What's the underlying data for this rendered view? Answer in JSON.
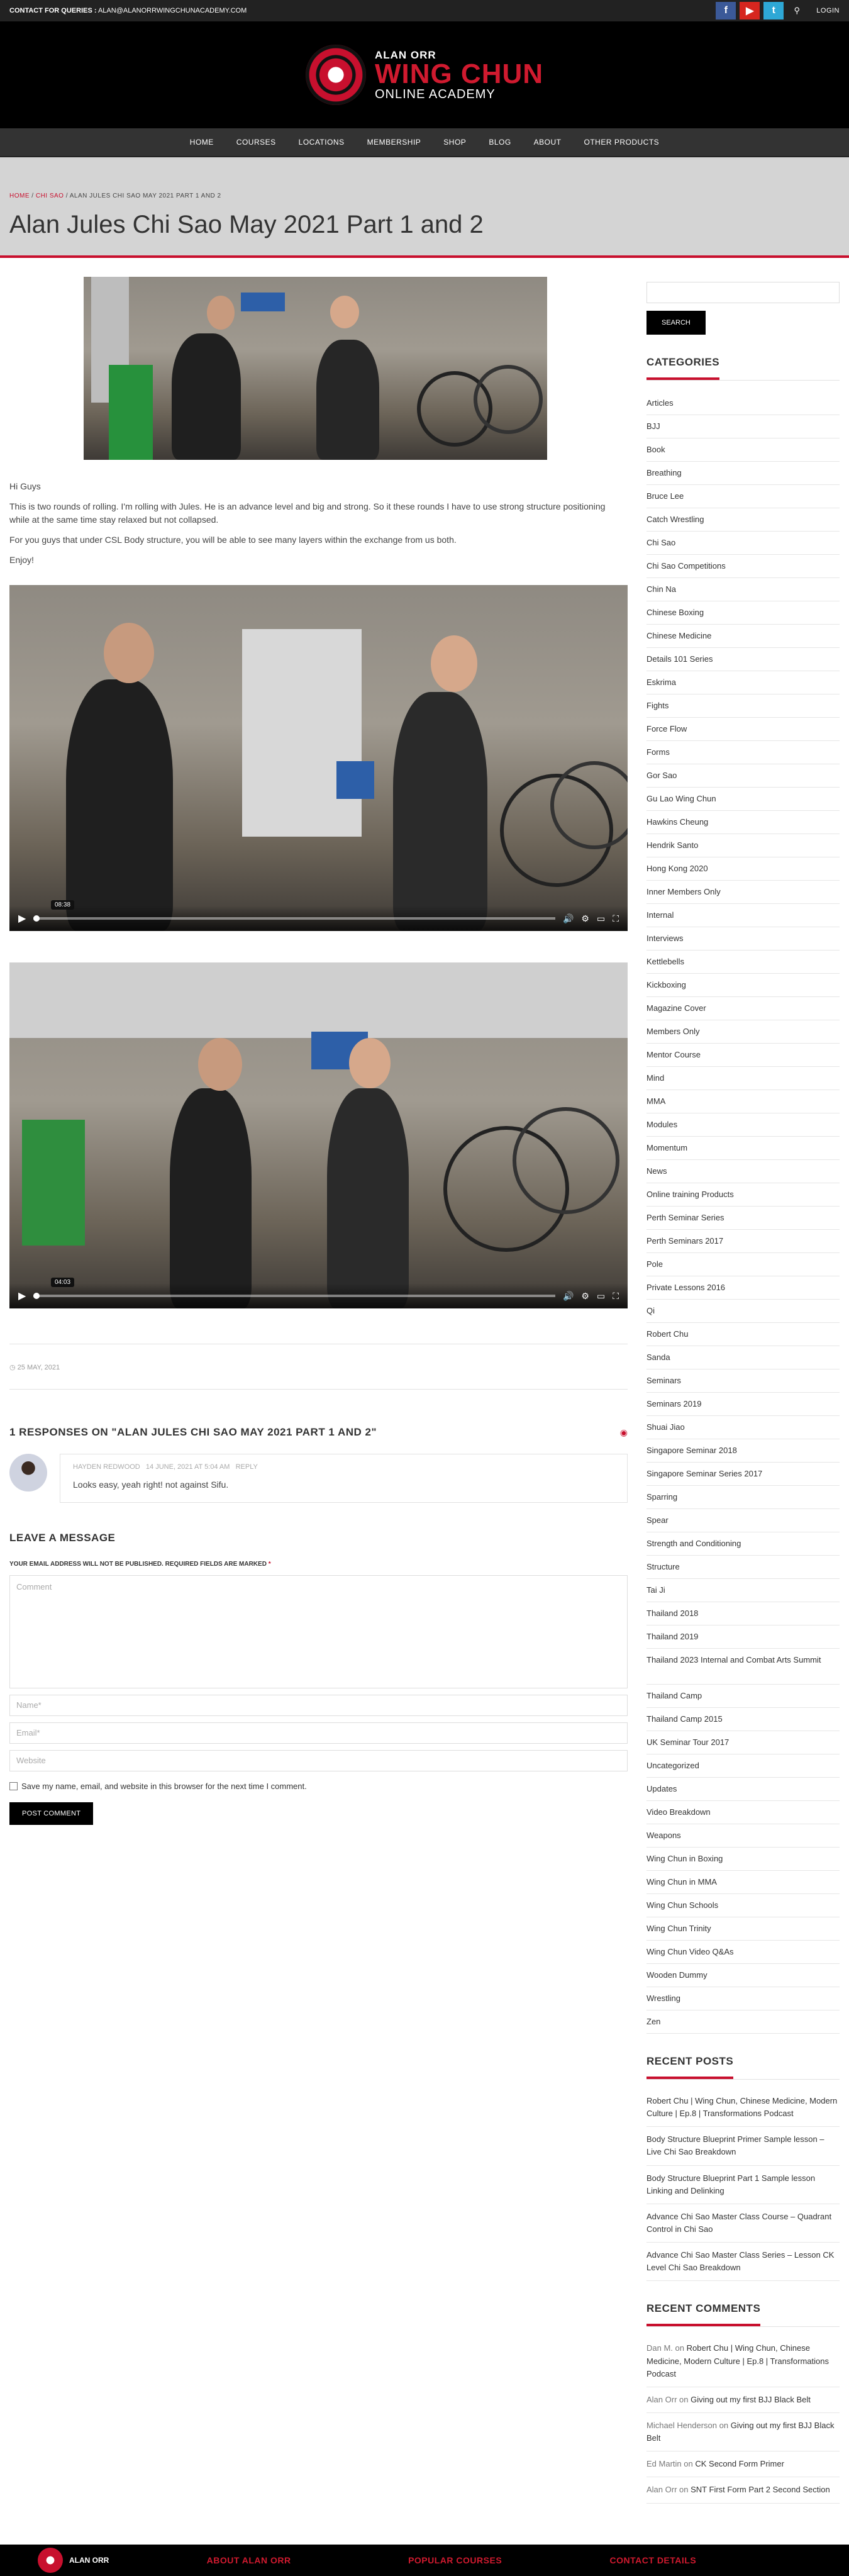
{
  "topbar": {
    "contact_label": "CONTACT FOR QUERIES :",
    "contact_email": "ALAN@ALANORRWINGCHUNACADEMY.COM",
    "fb_glyph": "f",
    "yt_glyph": "▶",
    "tw_glyph": "t",
    "search_glyph": "⚲",
    "login": "LOGIN"
  },
  "logo": {
    "line1": "ALAN ORR",
    "line2": "WING CHUN",
    "line3": "ONLINE ACADEMY"
  },
  "nav": [
    "HOME",
    "COURSES",
    "LOCATIONS",
    "MEMBERSHIP",
    "SHOP",
    "BLOG",
    "ABOUT",
    "OTHER PRODUCTS"
  ],
  "breadcrumb": {
    "home": "HOME",
    "sep": "/",
    "cat": "CHI SAO",
    "current": "ALAN JULES CHI SAO MAY 2021 PART 1 AND 2"
  },
  "page_title": "Alan Jules Chi Sao May 2021 Part 1 and 2",
  "post": {
    "p1": "Hi Guys",
    "p2": "This is two rounds of rolling. I'm rolling with Jules. He is an advance level and big and strong. So it these rounds I have to use strong structure positioning while at the same time stay relaxed but not collapsed.",
    "p3": "For you guys that under CSL Body structure, you will be able to see many layers within the exchange from us both.",
    "p4": "Enjoy!"
  },
  "videos": [
    {
      "time": "08:38",
      "progress": 0
    },
    {
      "time": "04:03",
      "progress": 0
    }
  ],
  "icons": {
    "play": "▶",
    "volume": "🔊",
    "settings": "⚙",
    "pip": "▭",
    "fullscreen": "⛶",
    "clock": "◷",
    "rss": "◉"
  },
  "date": "25 MAY, 2021",
  "responses_title": "1 RESPONSES ON \"ALAN JULES CHI SAO MAY 2021 PART 1 AND 2\"",
  "comment": {
    "author": "HAYDEN REDWOOD",
    "date": "14 JUNE, 2021 AT 5:04 AM",
    "reply": "REPLY",
    "text": "Looks easy, yeah right! not against Sifu."
  },
  "form": {
    "title": "LEAVE A MESSAGE",
    "notice": "YOUR EMAIL ADDRESS WILL NOT BE PUBLISHED. REQUIRED FIELDS ARE MARKED",
    "req": "*",
    "comment_ph": "Comment",
    "name_ph": "Name*",
    "email_ph": "Email*",
    "website_ph": "Website",
    "save_label": "Save my name, email, and website in this browser for the next time I comment.",
    "submit": "POST COMMENT"
  },
  "sidebar": {
    "search_btn": "SEARCH",
    "categories_title": "CATEGORIES",
    "categories": [
      "Articles",
      "BJJ",
      "Book",
      "Breathing",
      "Bruce Lee",
      "Catch Wrestling",
      "Chi Sao",
      "Chi Sao Competitions",
      "Chin Na",
      "Chinese Boxing",
      "Chinese Medicine",
      "Details 101 Series",
      "Eskrima",
      "Fights",
      "Force Flow",
      "Forms",
      "Gor Sao",
      "Gu Lao Wing Chun",
      "Hawkins Cheung",
      "Hendrik Santo",
      "Hong Kong 2020",
      "Inner Members Only",
      "Internal",
      "Interviews",
      "Kettlebells",
      "Kickboxing",
      "Magazine Cover",
      "Members Only",
      "Mentor Course",
      "Mind",
      "MMA",
      "Modules",
      "Momentum",
      "News",
      "Online training Products",
      "Perth Seminar Series",
      "Perth Seminars 2017",
      "Pole",
      "Private Lessons 2016",
      "Qi",
      "Robert Chu",
      "Sanda",
      "Seminars",
      "Seminars 2019",
      "Shuai Jiao",
      "Singapore Seminar 2018",
      "Singapore Seminar Series 2017",
      "Sparring",
      "Spear",
      "Strength and Conditioning",
      "Structure",
      "Tai Ji",
      "Thailand 2018",
      "Thailand 2019",
      "Thailand 2023 Internal and Combat Arts Summit",
      "Thailand Camp",
      "Thailand Camp 2015",
      "UK Seminar Tour 2017",
      "Uncategorized",
      "Updates",
      "Video Breakdown",
      "Weapons",
      "Wing Chun in Boxing",
      "Wing Chun in MMA",
      "Wing Chun Schools",
      "Wing Chun Trinity",
      "Wing Chun Video Q&As",
      "Wooden Dummy",
      "Wrestling",
      "Zen"
    ],
    "recent_posts_title": "RECENT POSTS",
    "recent_posts": [
      "Robert Chu | Wing Chun, Chinese Medicine, Modern Culture | Ep.8 | Transformations Podcast",
      "Body Structure Blueprint Primer Sample lesson – Live Chi Sao Breakdown",
      "Body Structure Blueprint Part 1 Sample lesson Linking and Delinking",
      "Advance Chi Sao Master Class Course – Quadrant Control in Chi Sao",
      "Advance Chi Sao Master Class Series – Lesson CK Level Chi Sao Breakdown"
    ],
    "recent_comments_title": "RECENT COMMENTS",
    "recent_comments": [
      {
        "author": "Dan M.",
        "on": "on",
        "post": "Robert Chu | Wing Chun, Chinese Medicine, Modern Culture | Ep.8 | Transformations Podcast"
      },
      {
        "author": "Alan Orr",
        "on": "on",
        "post": "Giving out my first BJJ Black Belt"
      },
      {
        "author": "Michael Henderson",
        "on": "on",
        "post": "Giving out my first BJJ Black Belt"
      },
      {
        "author": "Ed Martin",
        "on": "on",
        "post": "CK Second Form Primer"
      },
      {
        "author": "Alan Orr",
        "on": "on",
        "post": "SNT First Form Part 2 Second Section"
      }
    ]
  },
  "footer": {
    "logo_text": "ALAN ORR",
    "col1": "ABOUT ALAN ORR",
    "col2": "POPULAR COURSES",
    "col3": "CONTACT DETAILS"
  }
}
